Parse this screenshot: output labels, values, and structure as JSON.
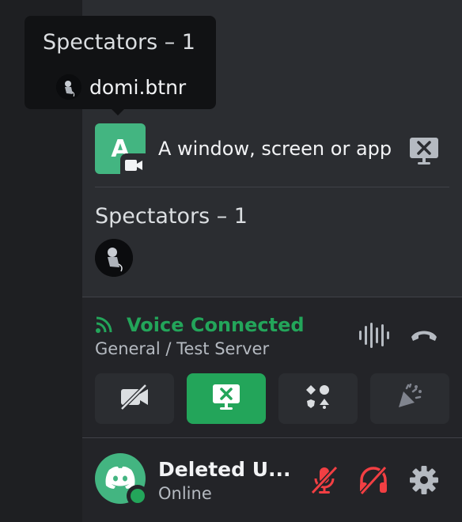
{
  "tooltip": {
    "title": "Spectators – 1",
    "username": "domi.btnr"
  },
  "stream": {
    "avatar_letter": "A",
    "label": "A window, screen or app",
    "stop_icon": "stop-streaming-icon"
  },
  "spectators": {
    "heading": "Spectators – 1"
  },
  "voice": {
    "status": "Voice Connected",
    "channel": "General / Test Server"
  },
  "actions": [
    {
      "name": "camera",
      "icon": "camera-off-icon",
      "active": false
    },
    {
      "name": "screen-share",
      "icon": "screen-share-stop-icon",
      "active": true
    },
    {
      "name": "activities",
      "icon": "activities-icon",
      "active": false
    },
    {
      "name": "soundboard",
      "icon": "soundboard-icon",
      "active": false
    }
  ],
  "user": {
    "name": "Deleted U...",
    "status": "Online"
  },
  "colors": {
    "green": "#23a55a",
    "red": "#f23f43",
    "stream_avatar": "#43b581"
  }
}
